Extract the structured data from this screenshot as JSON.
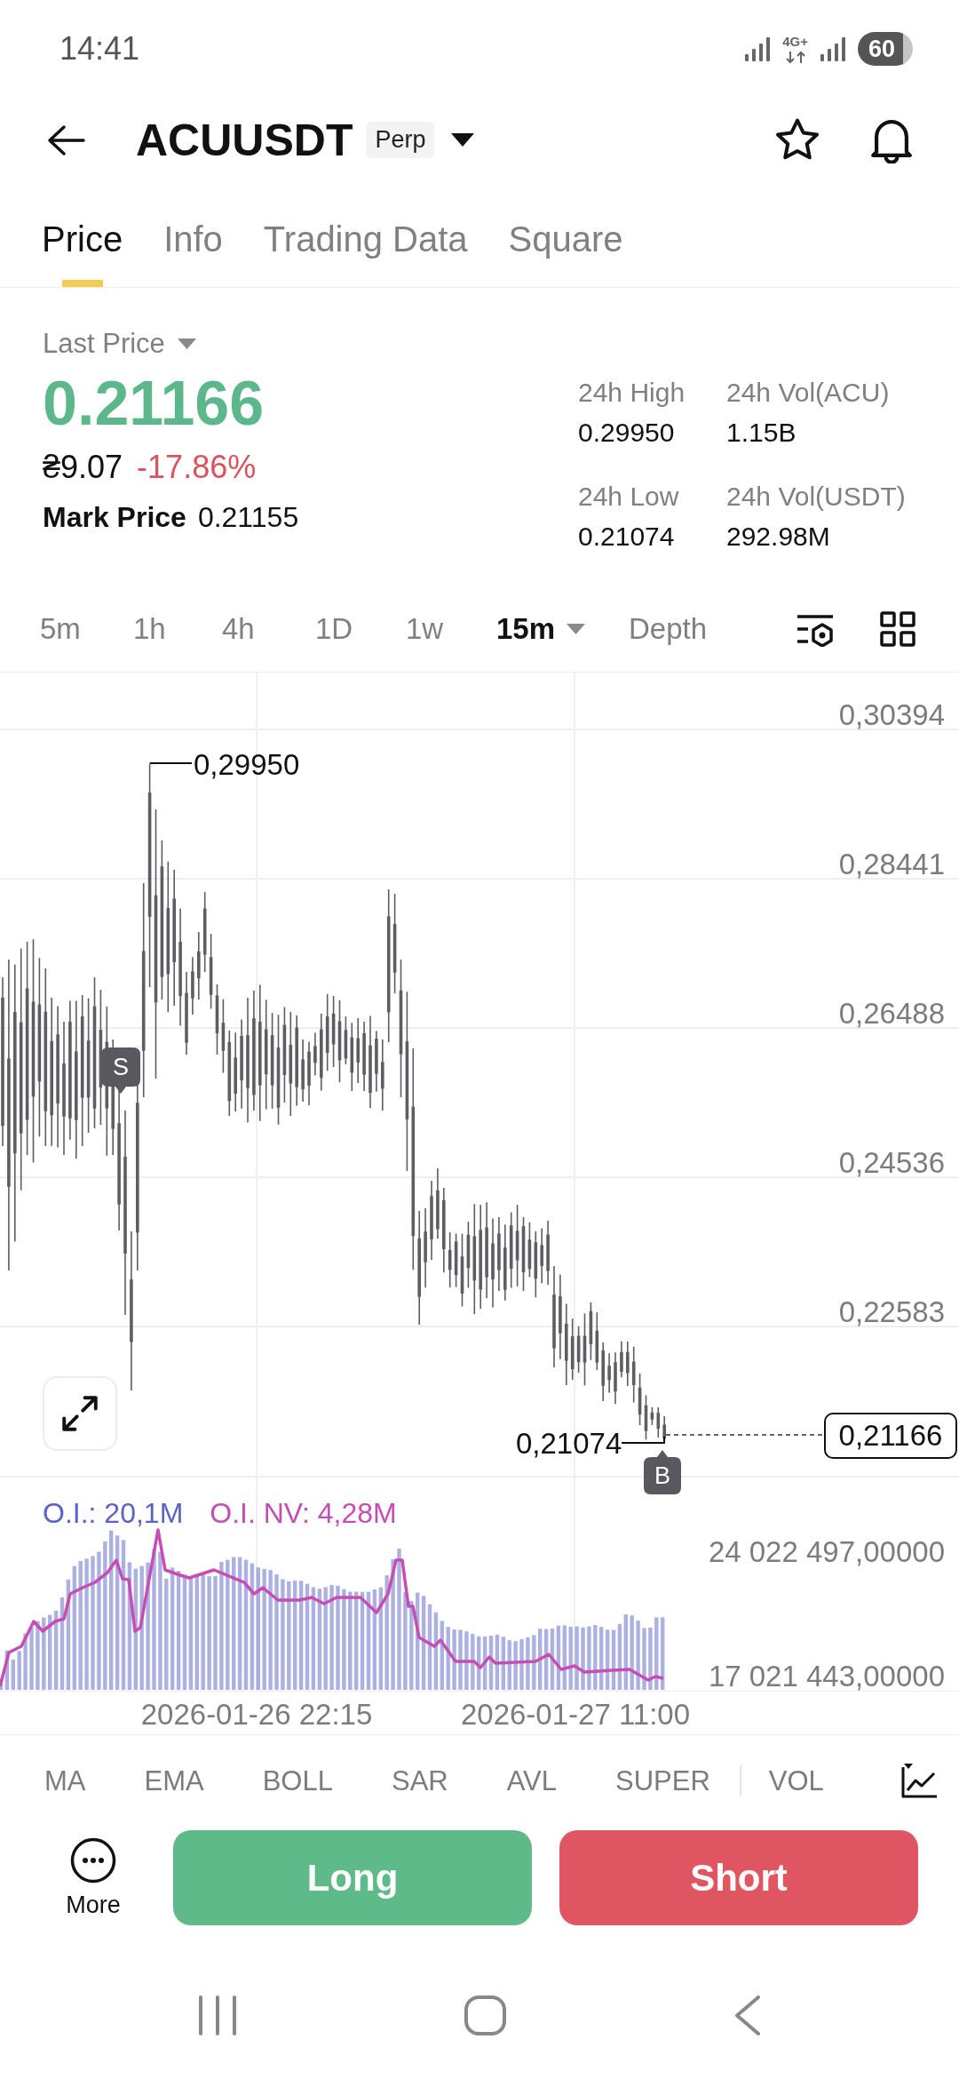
{
  "status_bar": {
    "time": "14:41",
    "network": "4G+",
    "battery": "60"
  },
  "header": {
    "symbol": "ACUUSDT",
    "contract_tag": "Perp"
  },
  "tabs": [
    {
      "label": "Price",
      "selected": true
    },
    {
      "label": "Info",
      "selected": false
    },
    {
      "label": "Trading Data",
      "selected": false
    },
    {
      "label": "Square",
      "selected": false
    }
  ],
  "ticker": {
    "price_type": "Last Price",
    "last_price": "0.21166",
    "fiat_price": "₴9.07",
    "change": "-17.86%",
    "mark_price_label": "Mark Price",
    "mark_price": "0.21155",
    "stats": [
      {
        "label": "24h High",
        "value": "0.29950"
      },
      {
        "label": "24h Vol(ACU)",
        "value": "1.15B"
      },
      {
        "label": "24h Low",
        "value": "0.21074"
      },
      {
        "label": "24h Vol(USDT)",
        "value": "292.98M"
      }
    ]
  },
  "intervals": [
    {
      "label": "5m",
      "kind": "option",
      "selected": false
    },
    {
      "label": "1h",
      "kind": "option",
      "selected": false
    },
    {
      "label": "4h",
      "kind": "option",
      "selected": false
    },
    {
      "label": "1D",
      "kind": "option",
      "selected": false
    },
    {
      "label": "1w",
      "kind": "option",
      "selected": false
    },
    {
      "label": "15m",
      "kind": "dropdown",
      "selected": true
    },
    {
      "label": "Depth",
      "kind": "option",
      "selected": false
    }
  ],
  "price_chart": {
    "y_axis_labels": [
      "0,30394",
      "0,28441",
      "0,26488",
      "0,24536",
      "0,22583"
    ],
    "high_label": "0,29950",
    "low_label": "0,21074",
    "current_price": "0,21166",
    "sell_marker": "S",
    "buy_marker": "B"
  },
  "open_interest": {
    "legend": [
      {
        "label": "O.I.: 20,1M",
        "color": "#5b63c4"
      },
      {
        "label": "O.I. NV: 4,28M",
        "color": "#c64db3"
      }
    ],
    "y_axis_labels": [
      "24 022 497,00000",
      "17 021 443,00000"
    ],
    "x_axis_labels": [
      "2026-01-26 22:15",
      "2026-01-27 11:00"
    ]
  },
  "indicators": {
    "main": [
      "MA",
      "EMA",
      "BOLL",
      "SAR",
      "AVL",
      "SUPER"
    ],
    "sub": [
      "VOL"
    ]
  },
  "actions": {
    "more": "More",
    "long": "Long",
    "short": "Short"
  }
}
